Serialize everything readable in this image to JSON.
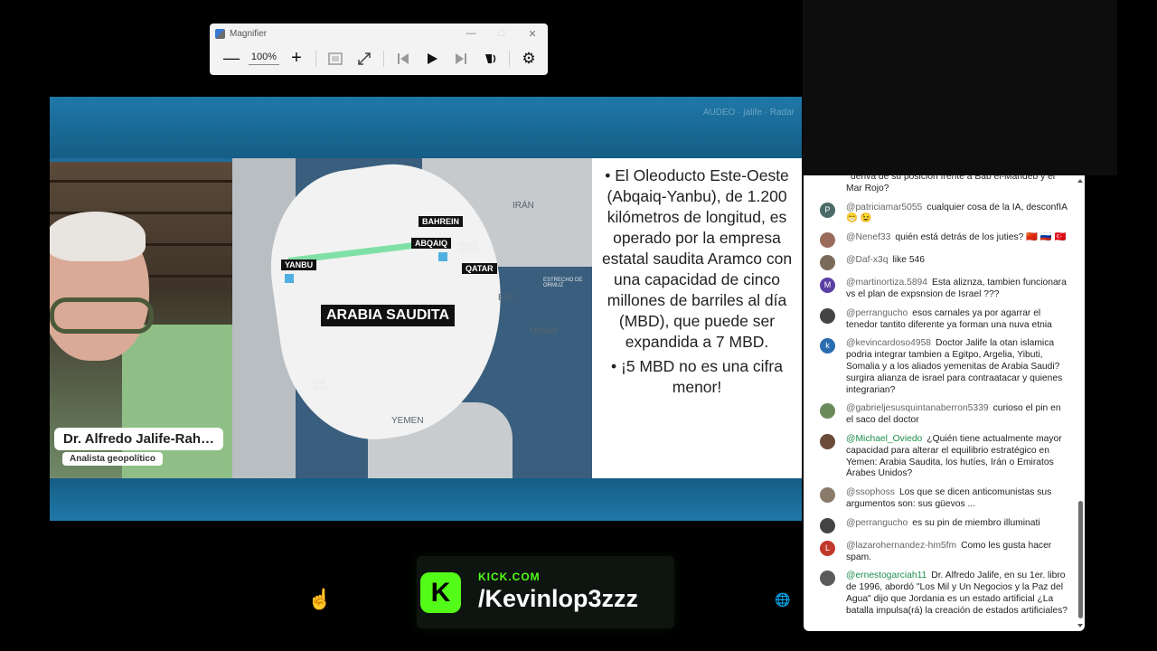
{
  "magnifier": {
    "title": "Magnifier",
    "zoom": "100%",
    "icons": [
      "zoom-out-icon",
      "zoom-in-icon",
      "fit-icon",
      "expand-icon",
      "previous-icon",
      "play-icon",
      "next-icon",
      "read-aloud-icon",
      "settings-icon"
    ]
  },
  "video": {
    "watermark": "AUDEO · jalife · Radar",
    "speaker_name": "Dr. Alfredo Jalife-Rah…",
    "speaker_role": "Analista geopolítico",
    "map_labels": {
      "country": "ARABIA SAUDITA",
      "yanbu": "YANBU",
      "abqaiq": "ABQAIQ",
      "bahrein": "BAHREIN",
      "qatar": "QATAR",
      "iran": "IRÁN",
      "eau": "EAU",
      "oman": "OMÁN",
      "yemen": "YEMEN",
      "golfo": "GOLFO PÉRSICO",
      "estrecho": "ESTRECHO DE ORMUZ",
      "mar_rojo": "MAR ROJO"
    },
    "bullet1": "• El Oleoducto Este-Oeste (Abqaiq-Yanbu), de 1.200 kilómetros de longitud, es operado por la empresa estatal saudita Aramco con una capacidad de cinco millones de barriles al día (MBD), que puede ser expandida a 7 MBD.",
    "bullet2": "• ¡5 MBD no es una cifra menor!"
  },
  "kick": {
    "domain": "KICK.COM",
    "handle": "/Kevinlop3zzz"
  },
  "chat": {
    "messages": [
      {
        "avatar": "",
        "avatar_color": "#fff",
        "user": "",
        "text": "deriva de su posición frente a Bab el-Mandeb y el Mar Rojo?"
      },
      {
        "avatar": "P",
        "avatar_color": "#4a6b67",
        "user": "@patriciamar5055",
        "text": "cualquier cosa de la IA, desconfIA 😁 😉"
      },
      {
        "avatar": "",
        "avatar_color": "#9a6b5b",
        "user": "@Nenef33",
        "text": "quién está detrás de los juties? 🇨🇳 🇷🇺 🇹🇷"
      },
      {
        "avatar": "",
        "avatar_color": "#7a6a5a",
        "user": "@Daf-x3q",
        "text": "like 546"
      },
      {
        "avatar": "M",
        "avatar_color": "#5b3fa3",
        "user": "@martinortiza.5894",
        "text": "Esta aliznza, tambien funcionara vs el plan de expsnsion de Israel ???"
      },
      {
        "avatar": "",
        "avatar_color": "#444",
        "user": "@perrangucho",
        "text": "esos carnales ya por agarrar el tenedor tantito diferente ya forman una nuva etnia"
      },
      {
        "avatar": "k",
        "avatar_color": "#2a6cb0",
        "user": "@kevincardoso4958",
        "text": "Doctor Jalife la otan islamica podria integrar tambien a Egitpo, Argelia, Yibuti, Somalia y a los aliados yemenitas de Arabia Saudi? surgira alianza de israel para contraatacar y quienes integrarian?"
      },
      {
        "avatar": "",
        "avatar_color": "#6a8a5a",
        "user": "@gabrieljesusquintanaberron5339",
        "text": "curioso el pin en el saco del doctor"
      },
      {
        "avatar": "",
        "avatar_color": "#6b4a3a",
        "user": "@Michael_Oviedo",
        "user_green": true,
        "text": "¿Quién tiene actualmente mayor capacidad para alterar el equilibrio estratégico en Yemen: Arabia Saudita, los hutíes, Irán o Emiratos Árabes Unidos?"
      },
      {
        "avatar": "",
        "avatar_color": "#8a7a6a",
        "user": "@ssophoss",
        "text": "Los que se dicen anticomunistas sus argumentos son: sus güevos ..."
      },
      {
        "avatar": "",
        "avatar_color": "#444",
        "user": "@perrangucho",
        "text": "es su pin de miembro illuminati"
      },
      {
        "avatar": "L",
        "avatar_color": "#c0392b",
        "user": "@lazarohernandez-hm5fm",
        "text": "Como les gusta hacer spam."
      },
      {
        "avatar": "",
        "avatar_color": "#5a5a5a",
        "user": "@ernestogarciah11",
        "user_green": true,
        "text": "Dr. Alfredo Jalife, en su 1er. libro de 1996, abordó \"Los Mil y Un Negocios y la Paz del Agua\" dijo que Jordania es un estado artificial ¿La batalla impulsa(rá) la creación de estados artificiales?"
      }
    ]
  }
}
